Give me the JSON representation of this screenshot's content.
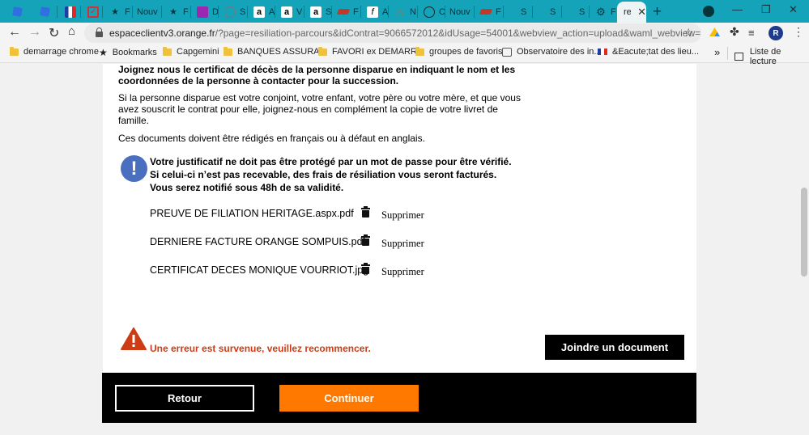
{
  "browser": {
    "tabs": [
      {
        "icon": "blue-square-icon",
        "label": "",
        "icon_color": "#2f6fe0"
      },
      {
        "icon": "blue-square-icon",
        "label": "",
        "icon_color": "#2f6fe0"
      },
      {
        "icon": "flag-fr-icon",
        "label": ""
      },
      {
        "icon": "red-check-icon",
        "label": "",
        "icon_color": "#d32f2f"
      },
      {
        "icon": "star-icon",
        "label": "F"
      },
      {
        "icon": "folder-icon",
        "label": "Nouv"
      },
      {
        "icon": "star-icon",
        "label": "F"
      },
      {
        "icon": "purple-app-icon",
        "label": "D"
      },
      {
        "icon": "gray-circle-icon",
        "label": "S"
      },
      {
        "icon": "amazon-icon",
        "label": "A"
      },
      {
        "icon": "amazon-icon",
        "label": "V"
      },
      {
        "icon": "amazon-icon",
        "label": "S"
      },
      {
        "icon": "card-icon",
        "label": "F"
      },
      {
        "icon": "f-script-icon",
        "label": "A"
      },
      {
        "icon": "house-icon",
        "label": "N"
      },
      {
        "icon": "globe-icon",
        "label": "C"
      },
      {
        "icon": "folder-icon",
        "label": "Nouv"
      },
      {
        "icon": "card-icon",
        "label": "F"
      },
      {
        "icon": "blank-icon",
        "label": "S"
      },
      {
        "icon": "blank-icon",
        "label": "S"
      },
      {
        "icon": "blank-icon",
        "label": "S"
      },
      {
        "icon": "gear-icon",
        "label": "F"
      }
    ],
    "active_tab": {
      "label": "re"
    },
    "url_host": "espaceclientv3.orange.fr",
    "url_path": "/?page=resiliation-parcours&idContrat=9066572012&idUsage=54001&webview_action=upload&waml_webview=",
    "profile_initial": "R",
    "bookmarks": [
      {
        "type": "folder",
        "label": "demarrage chrome"
      },
      {
        "type": "star",
        "label": "Bookmarks"
      },
      {
        "type": "folder",
        "label": "Capgemini"
      },
      {
        "type": "folder",
        "label": "BANQUES ASSURA..."
      },
      {
        "type": "folder",
        "label": "FAVORI ex DEMARR..."
      },
      {
        "type": "folder",
        "label": "groupes de favoris"
      },
      {
        "type": "site",
        "label": "Observatoire des in..."
      },
      {
        "type": "flag",
        "label": "&Eacute;tat des lieu..."
      }
    ],
    "more_bookmarks": "»",
    "reading_list": "Liste de lecture"
  },
  "page": {
    "intro_bold": [
      "Joignez nous le certificat de décès de la personne disparue en indiquant le nom et les",
      "coordonnées de la personne à contacter pour la succession."
    ],
    "paragraph_family": [
      "Si la personne disparue est votre conjoint, votre enfant, votre père ou votre mère, et que vous",
      "avez souscrit le contrat pour elle, joignez-nous en complément la copie de votre livret de",
      "famille."
    ],
    "paragraph_language": "Ces documents doivent être rédigés en français ou à défaut en anglais.",
    "info_symbol": "!",
    "info_lines": [
      "Votre justificatif ne doit pas être protégé par un mot de passe pour être vérifié.",
      "Si celui-ci n’est pas recevable, des frais de résiliation vous seront facturés.",
      "Vous serez notifié sous 48h de sa validité."
    ],
    "files": [
      {
        "name": "PREUVE DE FILIATION HERITAGE.aspx.pdf",
        "action": "Supprimer"
      },
      {
        "name": "DERNIERE FACTURE ORANGE SOMPUIS.pdf",
        "action": "Supprimer"
      },
      {
        "name": "CERTIFICAT DECES MONIQUE VOURRIOT.jpg",
        "action": "Supprimer"
      }
    ],
    "error_message": "Une erreur est survenue, veuillez recommencer.",
    "attach_button": "Joindre un document",
    "back_button": "Retour",
    "continue_button": "Continuer"
  },
  "colors": {
    "tabstrip": "#14a3b9",
    "orange": "#ff7900",
    "error_red": "#cd3c14",
    "info_blue": "#4a6fbf"
  }
}
